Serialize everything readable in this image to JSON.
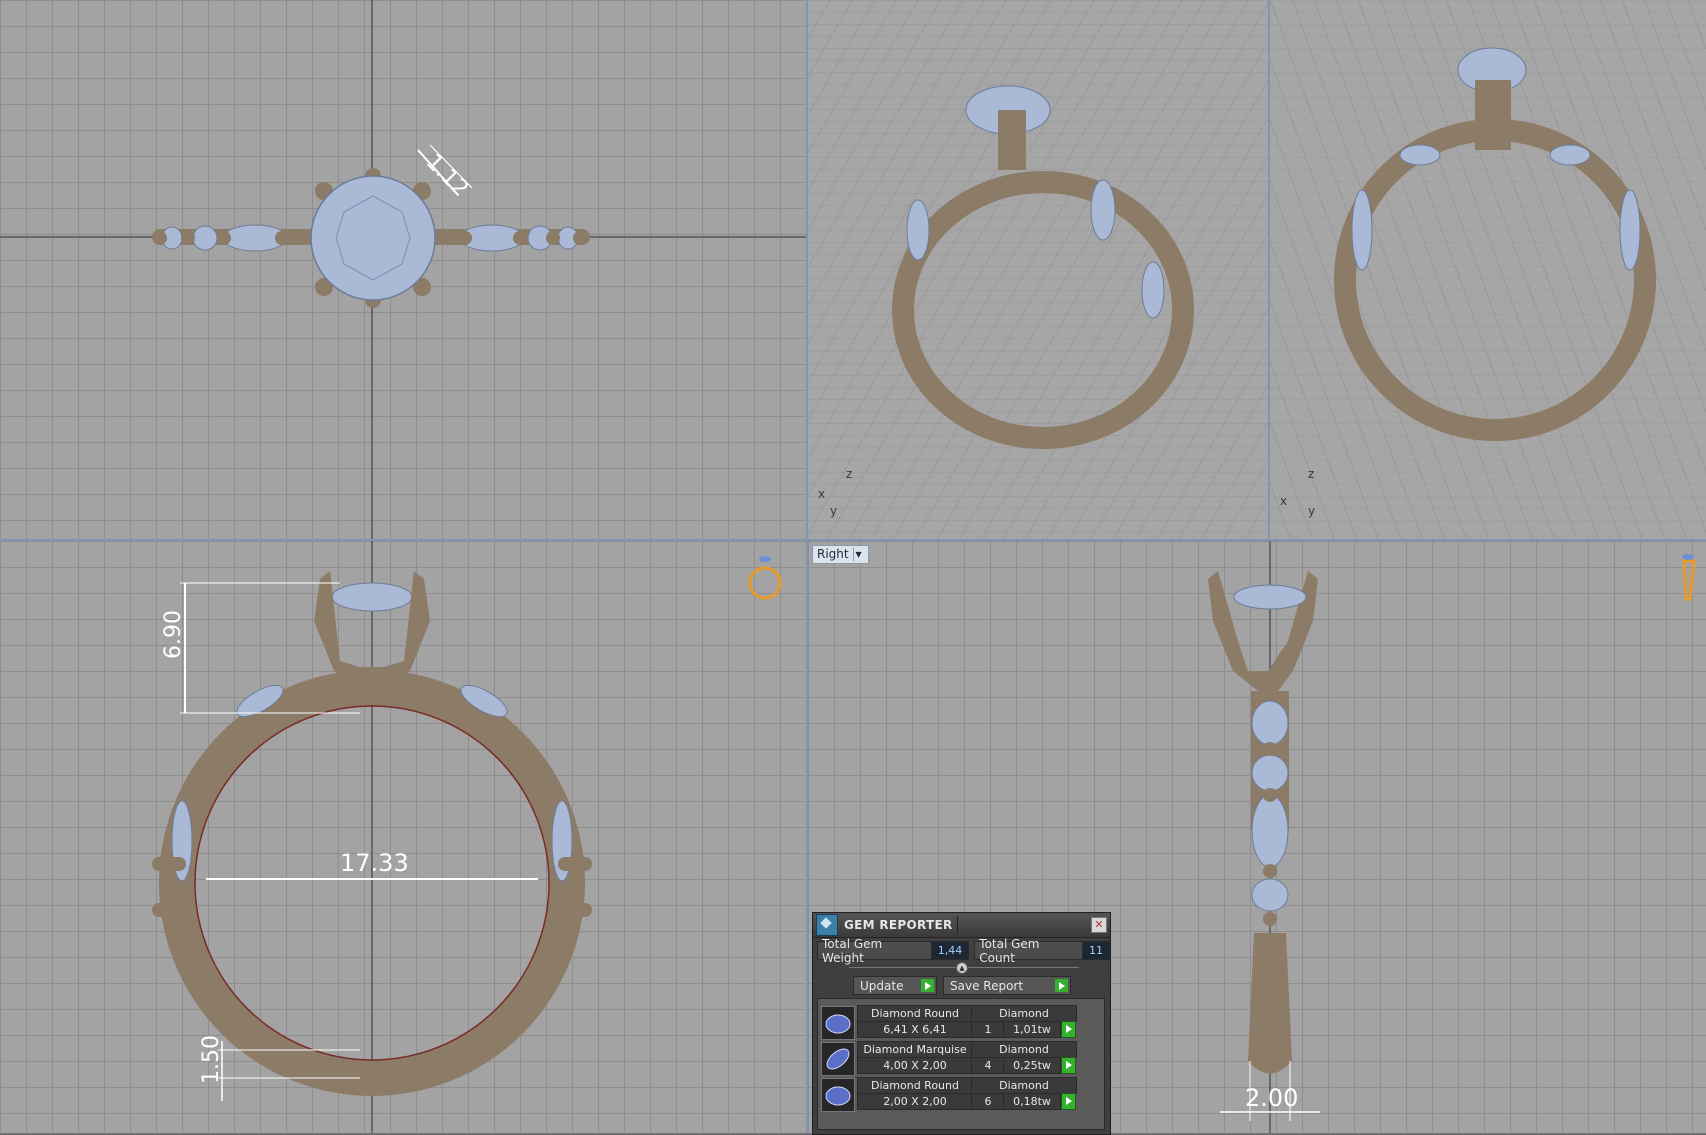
{
  "viewports": {
    "top": {
      "dim_prong": "1.12"
    },
    "front": {
      "dim_height": "6.90",
      "dim_inner": "17.33",
      "dim_shank": "1.50"
    },
    "right": {
      "label": "Right",
      "dim_width": "2.00"
    },
    "persp1": {
      "axis_x": "x",
      "axis_y": "y",
      "axis_z": "z"
    },
    "persp2": {
      "axis_x": "x",
      "axis_y": "y",
      "axis_z": "z"
    }
  },
  "gem_reporter": {
    "title": "GEM REPORTER",
    "total_weight_label": "Total Gem Weight",
    "total_weight_value": "1,44",
    "total_count_label": "Total Gem Count",
    "total_count_value": "11",
    "update_label": "Update",
    "save_label": "Save Report",
    "gems": [
      {
        "name": "Diamond Round",
        "material": "Diamond",
        "size": "6,41 X 6,41",
        "count": "1",
        "weight": "1,01tw"
      },
      {
        "name": "Diamond Marquise",
        "material": "Diamond",
        "size": "4,00 X 2,00",
        "count": "4",
        "weight": "0,25tw"
      },
      {
        "name": "Diamond Round",
        "material": "Diamond",
        "size": "2,00 X 2,00",
        "count": "6",
        "weight": "0,18tw"
      }
    ]
  },
  "colors": {
    "metal": "#8c7b66",
    "gem": "#a9b9d6",
    "dimension": "#ffffff",
    "accent": "#35b02f"
  },
  "icons": [
    "close-icon",
    "dropdown-arrow-icon",
    "ring-gizmo-icon",
    "gem-round-icon",
    "gem-marquise-icon"
  ]
}
